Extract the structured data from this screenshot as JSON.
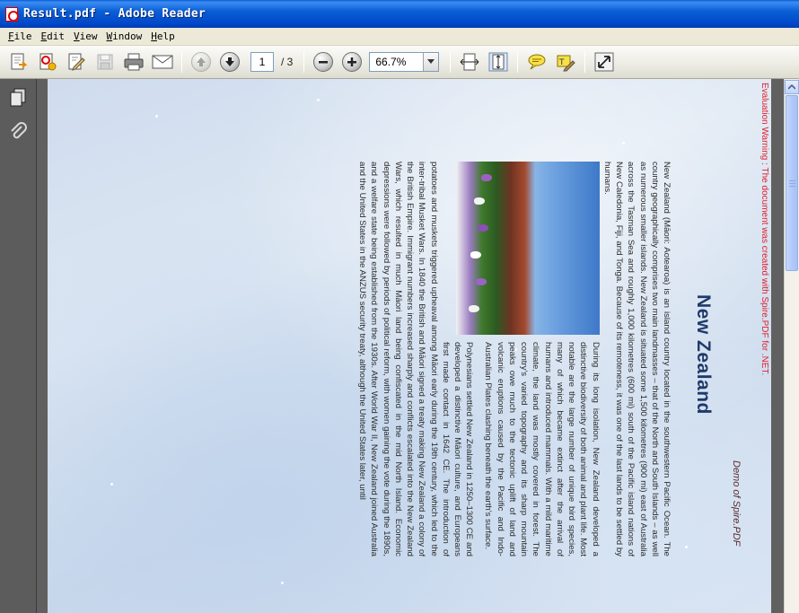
{
  "window": {
    "title": "Result.pdf - Adobe Reader"
  },
  "menu": {
    "items": [
      "File",
      "Edit",
      "View",
      "Window",
      "Help"
    ]
  },
  "toolbar": {
    "page_current": "1",
    "page_total": "/ 3",
    "zoom": "66.7%"
  },
  "document": {
    "eval_warning": "Evaluation Warning : The document was created with Spire.PDF for .NET.",
    "demo_label": "Demo of Spire.PDF",
    "title": "New Zealand",
    "paragraphs": [
      "New Zealand (Māori: Aotearoa) is an island country located in the southwestern Pacific Ocean. The country geographically comprises two main landmasses – that of the North and South Islands – as well as numerous smaller islands. New Zealand is situated some 1,500 kilometres (900 mi) east of Australia across the Tasman Sea and roughly 1,000 kilometres (600 mi) south of the Pacific island nations of New Caledonia, Fiji, and Tonga. Because of its remoteness, it was one of the last lands to be settled by humans.",
      "During its long isolation, New Zealand developed a distinctive biodiversity of both animal and plant life. Most notable are the large number of unique bird species, many of which became extinct after the arrival of humans and introduced mammals. With a mild maritime climate, the land was mostly covered in forest. The country's varied topography and its sharp mountain peaks owe much to the tectonic uplift of land and volcanic eruptions caused by the Pacific and Indo-Australian Plates clashing beneath the earth's surface.",
      "Polynesians settled New Zealand in 1250–1300 CE and developed a distinctive Māori culture, and Europeans first made contact in 1642 CE. The introduction of potatoes and muskets triggered upheaval among Māori early during the 19th century, which led to the inter-tribal Musket Wars. In 1840 the British and Māori signed a treaty making New Zealand a colony of the British Empire. Immigrant numbers increased sharply and conflicts escalated into the New Zealand Wars, which resulted in much Māori land being confiscated in the mid North Island. Economic depressions were followed by periods of political reform, with women gaining the vote during the 1890s, and a welfare state being established from the 1930s. After World War II, New Zealand joined Australia and the United States in the ANZUS security treaty, although the United States later, until"
    ]
  },
  "colors": {
    "titlebar": "#0a5fd6",
    "eval_warning": "#e0202c",
    "doc_title": "#1f3a6a",
    "nav_panel": "#5c5c5c"
  },
  "icons": {
    "left_panel": [
      "pages-icon",
      "attachment-icon"
    ]
  }
}
